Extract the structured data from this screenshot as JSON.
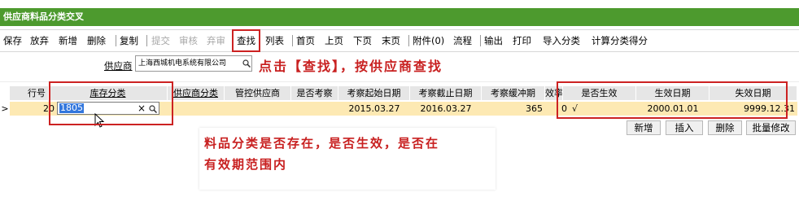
{
  "window": {
    "title": "供应商料品分类交叉"
  },
  "toolbar": {
    "items": [
      {
        "label": "保存",
        "disabled": false
      },
      {
        "label": "放弃",
        "disabled": false
      },
      {
        "label": "新增",
        "disabled": false
      },
      {
        "label": "删除",
        "disabled": false
      },
      {
        "label": "复制",
        "disabled": false
      },
      {
        "label": "提交",
        "disabled": true
      },
      {
        "label": "审核",
        "disabled": true
      },
      {
        "label": "弃审",
        "disabled": true
      },
      {
        "label": "查找",
        "disabled": false,
        "highlighted": true
      },
      {
        "label": "列表",
        "disabled": false
      },
      {
        "label": "首页",
        "disabled": false
      },
      {
        "label": "上页",
        "disabled": false
      },
      {
        "label": "下页",
        "disabled": false
      },
      {
        "label": "末页",
        "disabled": false
      },
      {
        "label": "附件(0)",
        "disabled": false
      },
      {
        "label": "流程",
        "disabled": false
      },
      {
        "label": "输出",
        "disabled": false
      },
      {
        "label": "打印",
        "disabled": false
      },
      {
        "label": "导入分类",
        "disabled": false
      },
      {
        "label": "计算分类得分",
        "disabled": false
      }
    ]
  },
  "filter": {
    "supplier_label": "供应商",
    "supplier_value": "上海西城机电系统有限公司"
  },
  "annotation_find": "点击【查找】，按供应商查找",
  "grid": {
    "columns": [
      "行号",
      "库存分类",
      "供应商分类",
      "管控供应商",
      "是否考察",
      "考察起始日期",
      "考察截止日期",
      "考察缓冲期",
      "效率",
      "是否生效",
      "生效日期",
      "失效日期"
    ],
    "row": {
      "marker": ">",
      "line_no": "20",
      "inventory_class": "1805",
      "supplier_class": "",
      "controlled_supplier": "",
      "is_inspected": "",
      "inspect_start": "2015.03.27",
      "inspect_end": "2016.03.27",
      "buffer": "365",
      "rate": "0",
      "effective": "√",
      "effective_date": "2000.01.01",
      "expire_date": "9999.12.31"
    }
  },
  "row_buttons": [
    "新增",
    "插入",
    "删除",
    "批量修改"
  ],
  "note": {
    "line1": "料品分类是否存在，是否生效，是否在",
    "line2": "有效期范围内"
  },
  "colors": {
    "titlebar": "#4d9a2e",
    "highlight_row": "#fde9b3",
    "annotation": "#c82020"
  }
}
